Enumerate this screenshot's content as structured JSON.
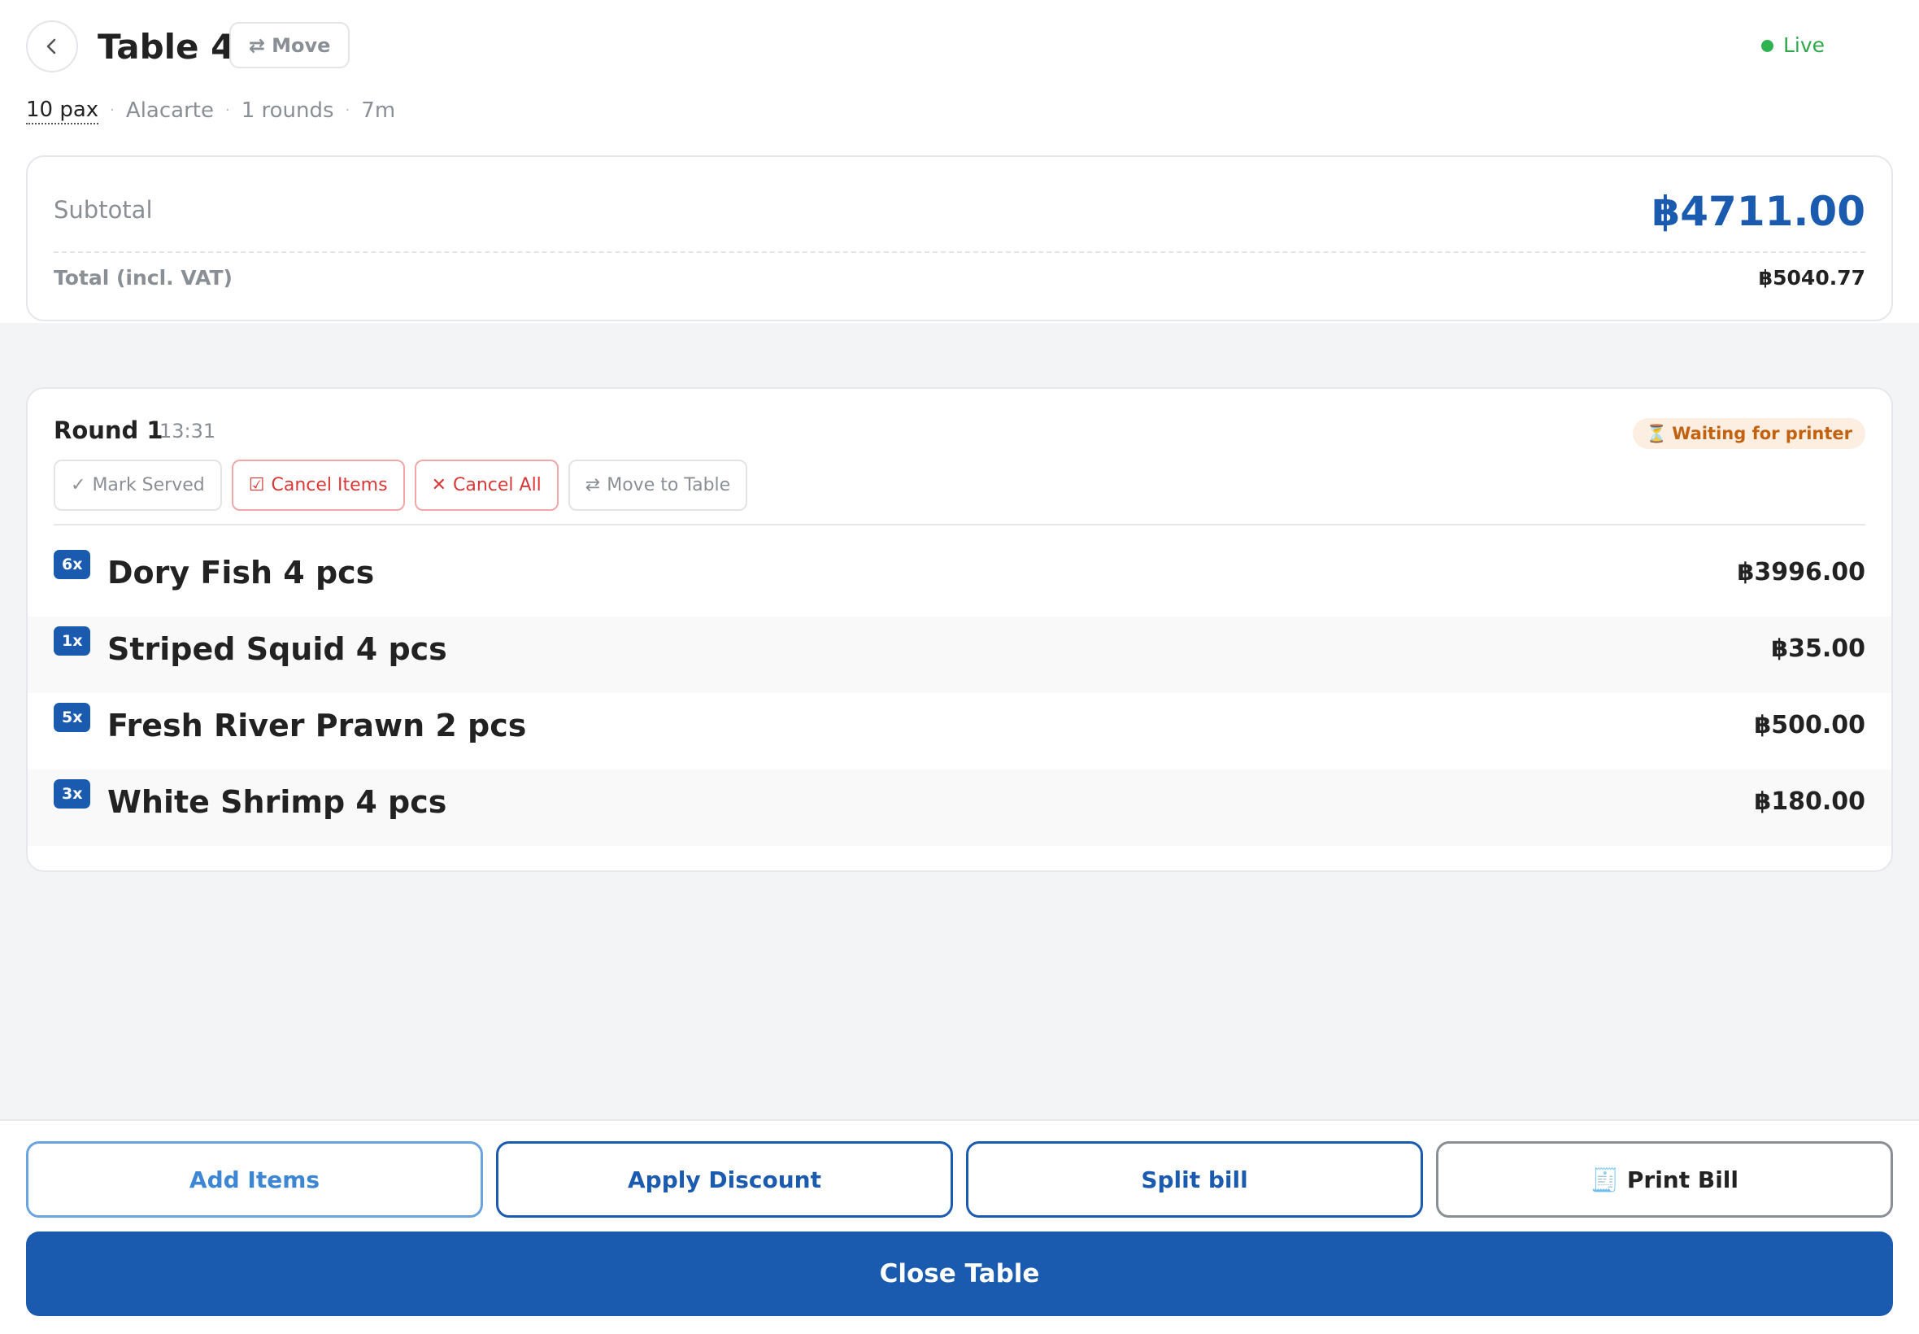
{
  "header": {
    "title": "Table 4",
    "move_icon": "⇄",
    "move_label": "Move",
    "status": "Live",
    "status_color": "#2fb350"
  },
  "meta": {
    "pax": "10 pax",
    "mode": "Alacarte",
    "rounds": "1 rounds",
    "elapsed": "7m",
    "separator": "·"
  },
  "summary": {
    "subtotal_label": "Subtotal",
    "subtotal_value": "฿4711.00",
    "total_label": "Total (incl. VAT)",
    "total_value": "฿5040.77"
  },
  "round": {
    "title": "Round 1",
    "time": "13:31",
    "status_icon": "⏳",
    "status": "Waiting for printer",
    "actions": {
      "mark_served_icon": "✓",
      "mark_served": "Mark Served",
      "cancel_items_icon": "☑",
      "cancel_items": "Cancel Items",
      "cancel_all_icon": "✕",
      "cancel_all": "Cancel All",
      "move_table_icon": "⇄",
      "move_table": "Move to Table"
    },
    "items": [
      {
        "qty": "6x",
        "name": "Dory Fish 4 pcs",
        "price": "฿3996.00"
      },
      {
        "qty": "1x",
        "name": "Striped Squid 4 pcs",
        "price": "฿35.00"
      },
      {
        "qty": "5x",
        "name": "Fresh River Prawn 2 pcs",
        "price": "฿500.00"
      },
      {
        "qty": "3x",
        "name": "White Shrimp 4 pcs",
        "price": "฿180.00"
      }
    ]
  },
  "footer": {
    "add_items": "Add Items",
    "apply_discount": "Apply Discount",
    "split_bill": "Split bill",
    "print_icon": "🧾",
    "print_bill": "Print Bill",
    "close_table": "Close Table"
  },
  "colors": {
    "accent": "#1a5bb0",
    "danger": "#d93838",
    "warning": "#c2620e"
  }
}
